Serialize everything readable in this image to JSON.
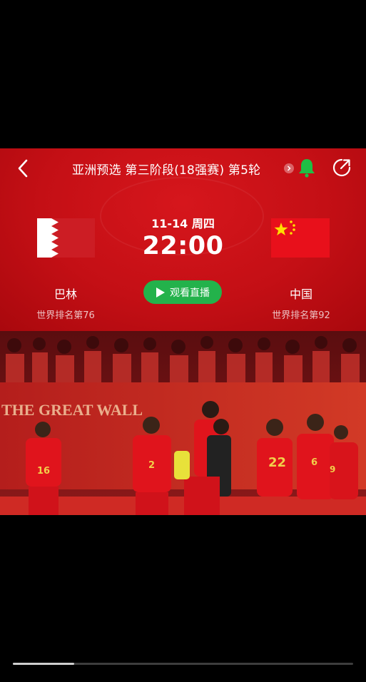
{
  "header": {
    "title": "亚洲预选 第三阶段(18强赛) 第5轮",
    "back_icon": "chevron-left-icon",
    "bell_icon": "bell-icon",
    "share_icon": "share-icon"
  },
  "match": {
    "date": "11-14 周四",
    "time": "22:00",
    "watch_label": "观看直播",
    "home": {
      "name": "巴林",
      "rank": "世界排名第76",
      "flag": "bahrain-flag"
    },
    "away": {
      "name": "中国",
      "rank": "世界排名第92",
      "flag": "china-flag"
    }
  },
  "photo": {
    "banner_text": "THE GREAT WALL",
    "jersey_numbers": [
      "16",
      "2",
      "22",
      "6",
      "9"
    ]
  },
  "video": {
    "progress": 0.18
  },
  "colors": {
    "card_red": "#c40f15",
    "watch_green": "#23b24b",
    "bell_green": "#1fbe45"
  }
}
